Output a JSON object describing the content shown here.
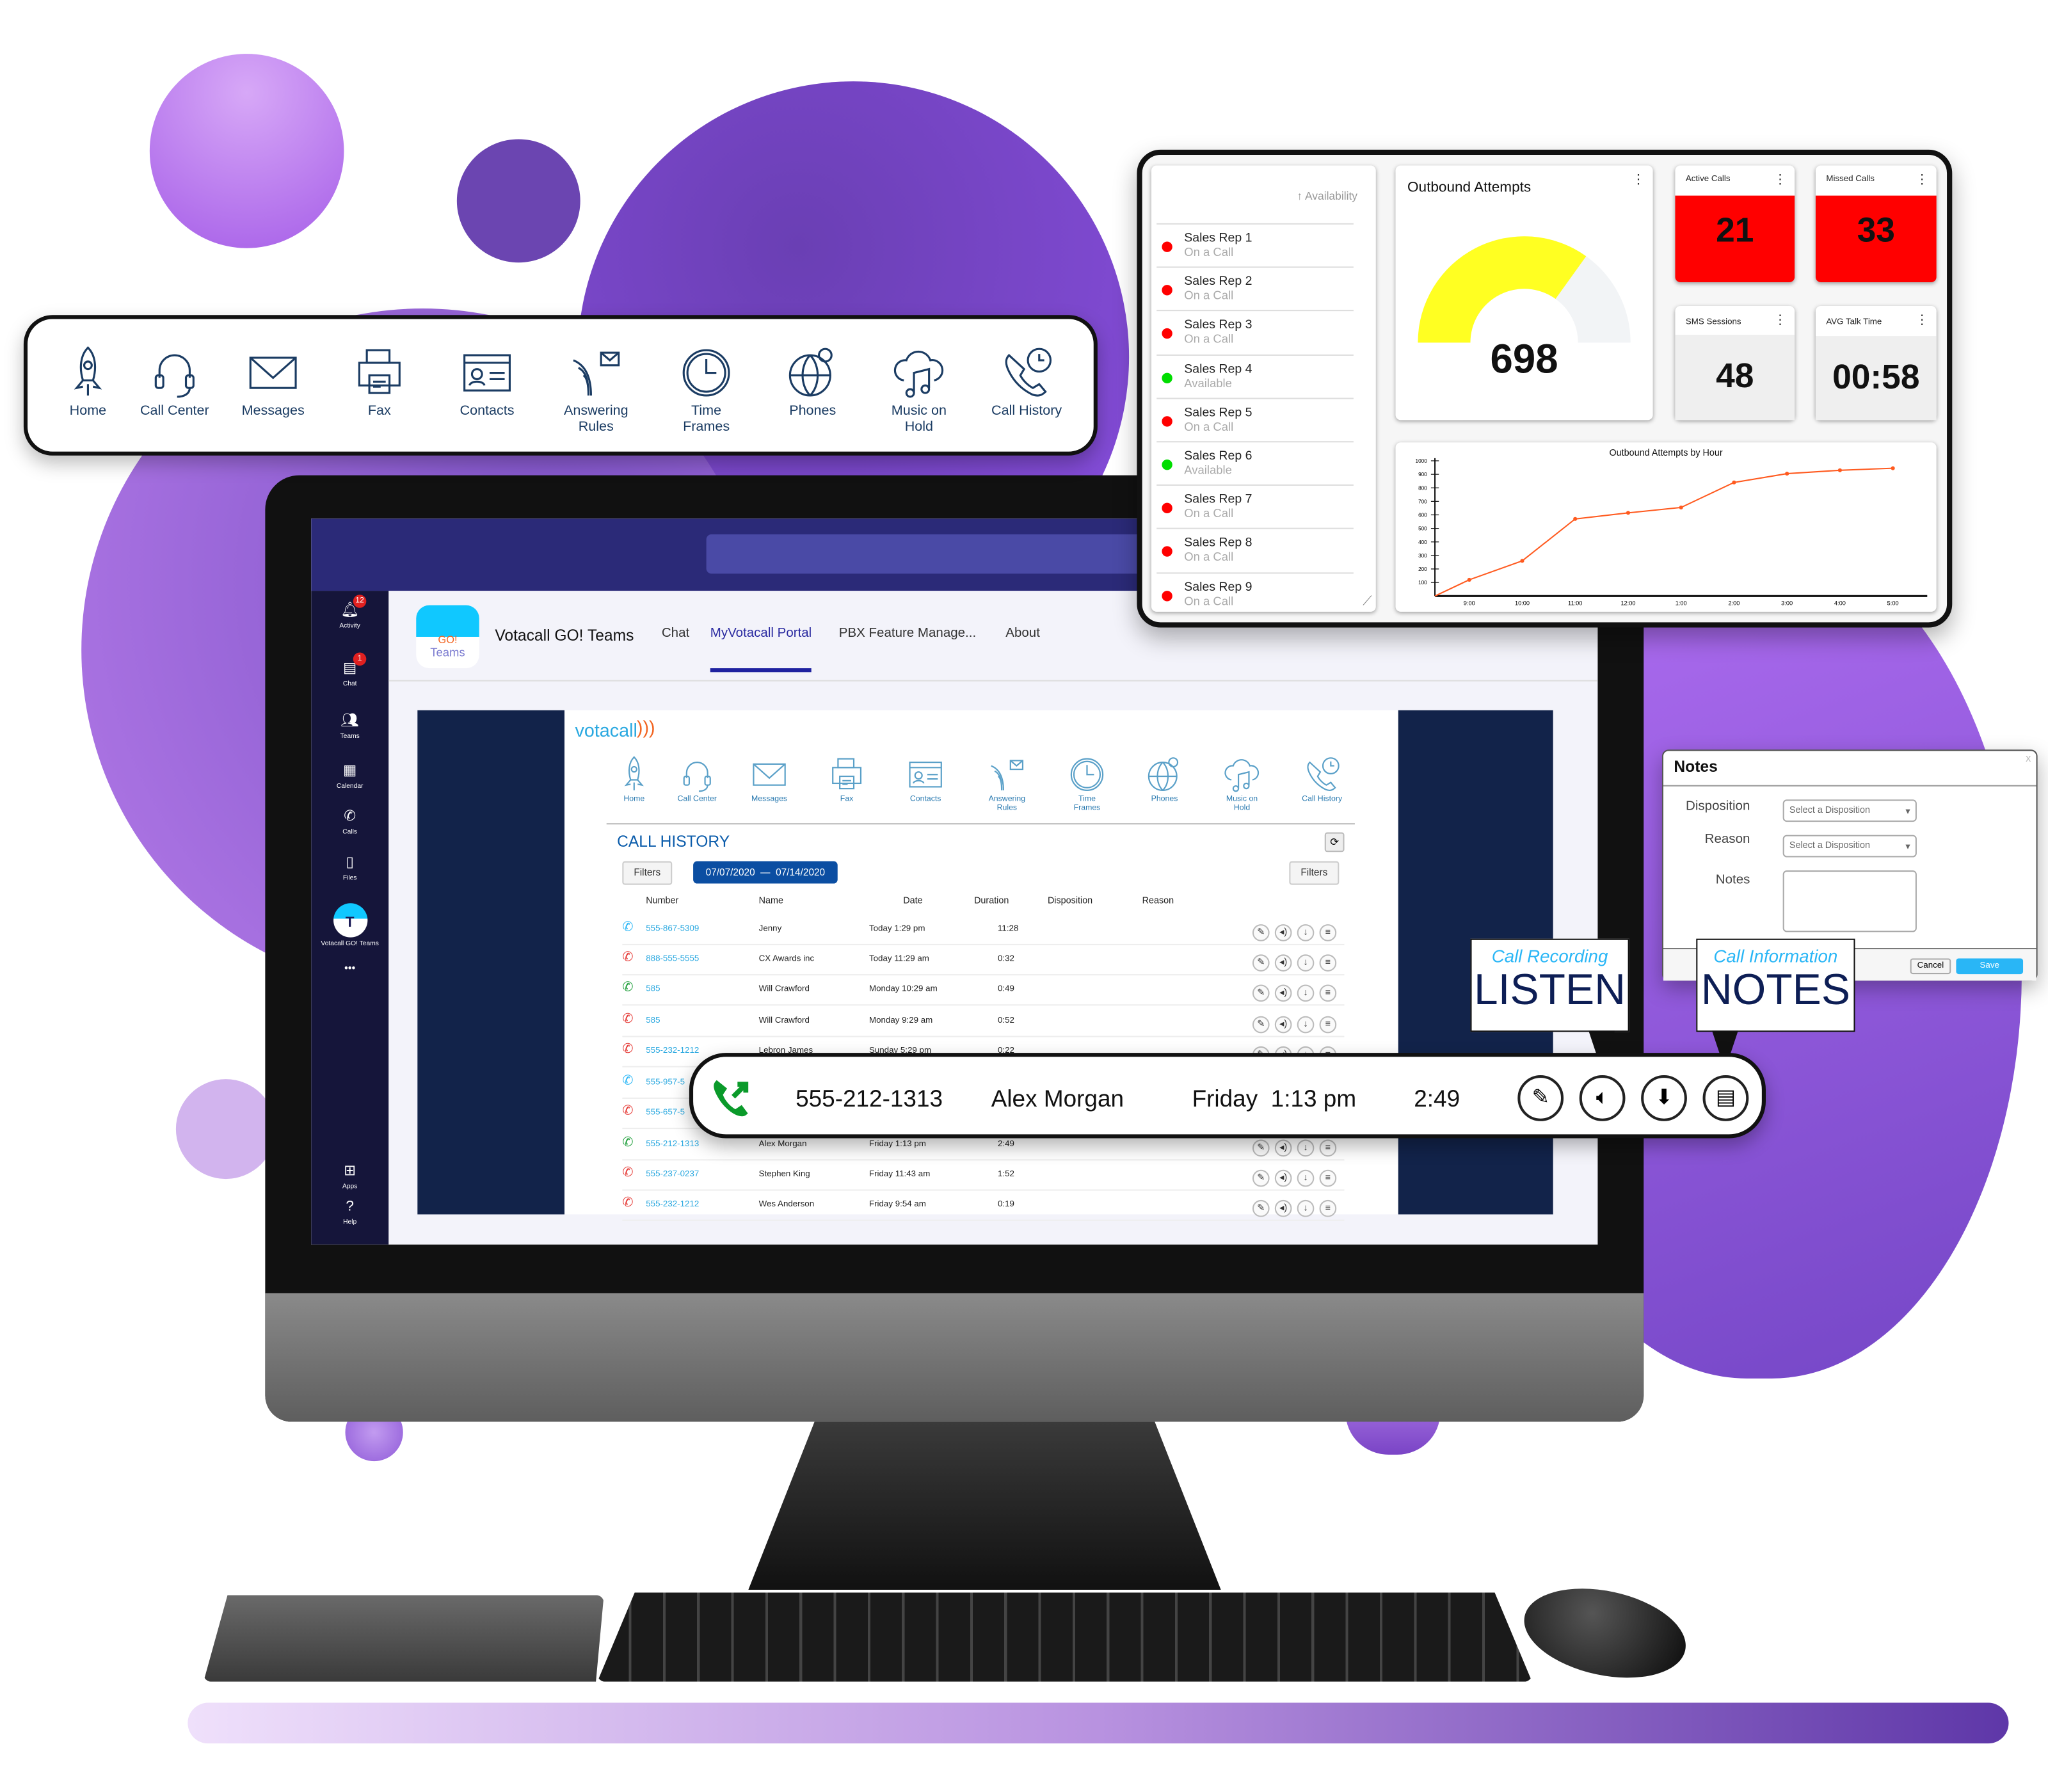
{
  "colors": {
    "purple": "#7a4fcf",
    "light_purple": "#c07ef0",
    "navy": "#12234a",
    "teams_bar": "#2b2a78",
    "link": "#29a8e0",
    "red": "#ff0000",
    "green": "#00dd00",
    "gauge": "#ffff22",
    "line": "#ff5a1f"
  },
  "icon_bar": {
    "items": [
      {
        "label": "Home",
        "icon": "rocket-icon"
      },
      {
        "label": "Call Center",
        "icon": "headset-icon"
      },
      {
        "label": "Messages",
        "icon": "envelope-icon"
      },
      {
        "label": "Fax",
        "icon": "fax-icon"
      },
      {
        "label": "Contacts",
        "icon": "contact-card-icon"
      },
      {
        "label": "Answering Rules",
        "icon": "answering-rules-icon"
      },
      {
        "label": "Time Frames",
        "icon": "clock-icon"
      },
      {
        "label": "Phones",
        "icon": "globe-icon"
      },
      {
        "label": "Music on Hold",
        "icon": "music-cloud-icon"
      },
      {
        "label": "Call History",
        "icon": "phone-clock-icon"
      }
    ]
  },
  "teams": {
    "rail": [
      {
        "label": "Activity",
        "icon": "bell-icon",
        "badge": "12"
      },
      {
        "label": "Chat",
        "icon": "chat-icon",
        "badge": "1"
      },
      {
        "label": "Teams",
        "icon": "teams-icon"
      },
      {
        "label": "Calendar",
        "icon": "calendar-icon"
      },
      {
        "label": "Calls",
        "icon": "phone-icon"
      },
      {
        "label": "Files",
        "icon": "file-icon"
      },
      {
        "label": "Votacall GO! Teams",
        "icon": "votacall-app-icon"
      },
      {
        "label": "Apps",
        "icon": "apps-icon"
      },
      {
        "label": "Help",
        "icon": "help-icon"
      }
    ],
    "more": "•••",
    "app_logo": {
      "top": "GO!",
      "bottom": "Teams"
    },
    "app_name": "Votacall GO! Teams",
    "tabs": [
      {
        "label": "Chat"
      },
      {
        "label": "MyVotacall Portal",
        "active": true
      },
      {
        "label": "PBX Feature Manage..."
      },
      {
        "label": "About"
      }
    ]
  },
  "portal": {
    "logo": "votacall",
    "title": "CALL HISTORY",
    "filters_left": "Filters",
    "filters_right": "Filters",
    "date_range": "07/07/2020  —  07/14/2020",
    "columns": [
      "Number",
      "Name",
      "Date",
      "Duration",
      "Disposition",
      "Reason"
    ],
    "rows": [
      {
        "type": "inbound",
        "number": "555-867-5309",
        "name": "Jenny",
        "date": "Today 1:29 pm",
        "duration": "11:28"
      },
      {
        "type": "missed",
        "number": "888-555-5555",
        "name": "CX Awards inc",
        "date": "Today 11:29 am",
        "duration": "0:32"
      },
      {
        "type": "outbound",
        "number": "585",
        "name": "Will Crawford",
        "date": "Monday 10:29 am",
        "duration": "0:49"
      },
      {
        "type": "missed",
        "number": "585",
        "name": "Will Crawford",
        "date": "Monday 9:29 am",
        "duration": "0:52"
      },
      {
        "type": "missed",
        "number": "555-232-1212",
        "name": "Lebron James",
        "date": "Sunday 5:29 pm",
        "duration": "0:22"
      },
      {
        "type": "inbound",
        "number": "555-957-5",
        "name": "",
        "date": "",
        "duration": ""
      },
      {
        "type": "missed",
        "number": "555-657-5",
        "name": "",
        "date": "",
        "duration": ""
      },
      {
        "type": "outbound",
        "number": "555-212-1313",
        "name": "Alex Morgan",
        "date": "Friday 1:13 pm",
        "duration": "2:49"
      },
      {
        "type": "missed",
        "number": "555-237-0237",
        "name": "Stephen King",
        "date": "Friday 11:43 am",
        "duration": "1:52"
      },
      {
        "type": "missed",
        "number": "555-232-1212",
        "name": "Wes Anderson",
        "date": "Friday 9:54 am",
        "duration": "0:19"
      }
    ]
  },
  "highlight": {
    "number": "555-212-1313",
    "name": "Alex Morgan",
    "date": "Friday  1:13 pm",
    "duration": "2:49"
  },
  "callouts": {
    "recording": {
      "sub": "Call Recording",
      "big": "LISTEN"
    },
    "info": {
      "sub": "Call Information",
      "big": "NOTES"
    }
  },
  "notes": {
    "title": "Notes",
    "close": "x",
    "disposition_label": "Disposition",
    "reason_label": "Reason",
    "notes_label": "Notes",
    "disposition_placeholder": "Select a Disposition",
    "reason_placeholder": "Select a Disposition",
    "notes_value": "",
    "cancel": "Cancel",
    "save": "Save"
  },
  "dashboard": {
    "availability_header": "Availability",
    "reps": [
      {
        "name": "Sales Rep 1",
        "status": "On a Call"
      },
      {
        "name": "Sales Rep 2",
        "status": "On a Call"
      },
      {
        "name": "Sales Rep 3",
        "status": "On a Call"
      },
      {
        "name": "Sales Rep 4",
        "status": "Available"
      },
      {
        "name": "Sales Rep 5",
        "status": "On a Call"
      },
      {
        "name": "Sales Rep 6",
        "status": "Available"
      },
      {
        "name": "Sales Rep 7",
        "status": "On a Call"
      },
      {
        "name": "Sales Rep 8",
        "status": "On a Call"
      },
      {
        "name": "Sales Rep 9",
        "status": "On a Call"
      }
    ],
    "outbound": {
      "title": "Outbound Attempts",
      "value": "698",
      "gauge_value": 698,
      "gauge_max": 1000
    },
    "active_calls": {
      "title": "Active Calls",
      "value": "21"
    },
    "missed_calls": {
      "title": "Missed Calls",
      "value": "33"
    },
    "sms": {
      "title": "SMS Sessions",
      "value": "48"
    },
    "avg_talk": {
      "title": "AVG Talk Time",
      "value": "00:58"
    }
  },
  "chart_data": {
    "type": "line",
    "title": "Outbound Attempts by Hour",
    "xlabel": "",
    "ylabel": "",
    "x": [
      "9:00",
      "10:00",
      "11:00",
      "12:00",
      "1:00",
      "2:00",
      "3:00",
      "4:00",
      "5:00"
    ],
    "values": [
      120,
      260,
      570,
      615,
      655,
      840,
      905,
      930,
      945
    ],
    "yticks": [
      100,
      200,
      300,
      400,
      500,
      600,
      700,
      800,
      900,
      1000
    ],
    "ylim": [
      0,
      1000
    ],
    "grid": false,
    "legend": "none"
  }
}
